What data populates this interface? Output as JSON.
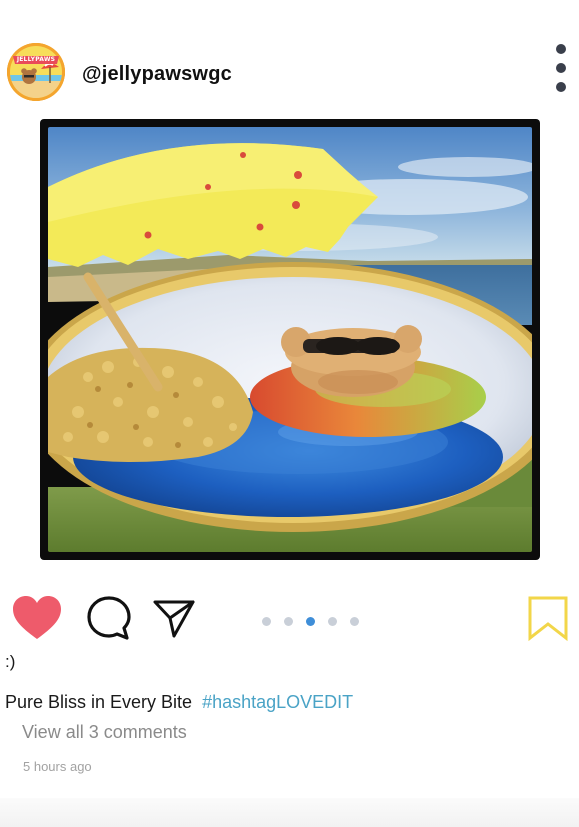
{
  "post": {
    "username": "@jellypawswgc",
    "avatar_badge_text": "JELLYPAWS",
    "likes_text": ":)",
    "caption_text": "Pure Bliss in Every Bite",
    "hashtag": "#hashtagLOVEDIT",
    "comments_link": "View all 3 comments",
    "timestamp": "5 hours ago"
  },
  "carousel": {
    "total": 5,
    "active_index": 2
  },
  "icons": {
    "more": "more-vertical-icon",
    "like": "heart-icon",
    "comment": "comment-bubble-icon",
    "share": "paper-plane-icon",
    "save": "bookmark-icon"
  },
  "colors": {
    "heart": "#ee5b6b",
    "bookmark": "#f2d649",
    "hashtag": "#4aa3c6",
    "pager_active": "#3f8ed8",
    "pager_inactive": "#c9cfd8"
  }
}
